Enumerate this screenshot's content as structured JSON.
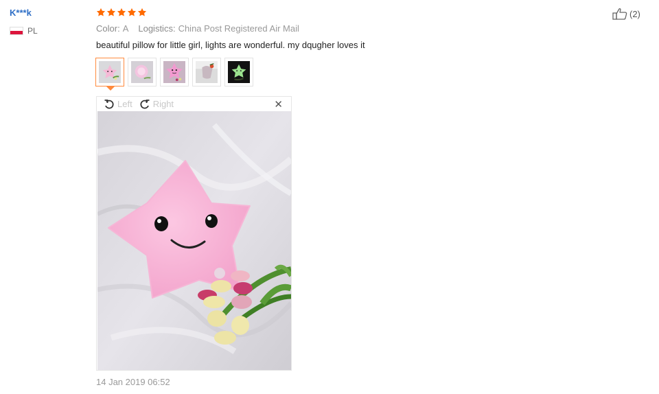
{
  "review": {
    "user_name": "K***k",
    "country_code": "PL",
    "rating": 5,
    "color_label": "Color:",
    "color_value": "A",
    "logistics_label": "Logistics:",
    "logistics_value": "China Post Registered Air Mail",
    "text": "beautiful pillow for little girl, lights are wonderful. my dqugher loves it",
    "helpful_count": "(2)",
    "date": "14 Jan 2019 06:52"
  },
  "viewer": {
    "rotate_left_label": "Left",
    "rotate_right_label": "Right",
    "close_symbol": "✕"
  },
  "thumbnails": [
    {
      "name": "photo-1",
      "selected": true
    },
    {
      "name": "photo-2",
      "selected": false
    },
    {
      "name": "photo-3",
      "selected": false
    },
    {
      "name": "photo-4",
      "selected": false
    },
    {
      "name": "photo-5",
      "selected": false
    }
  ],
  "colors": {
    "star": "#ff6a00",
    "link": "#2f6fc6",
    "selected_border": "#ff8a3d"
  }
}
